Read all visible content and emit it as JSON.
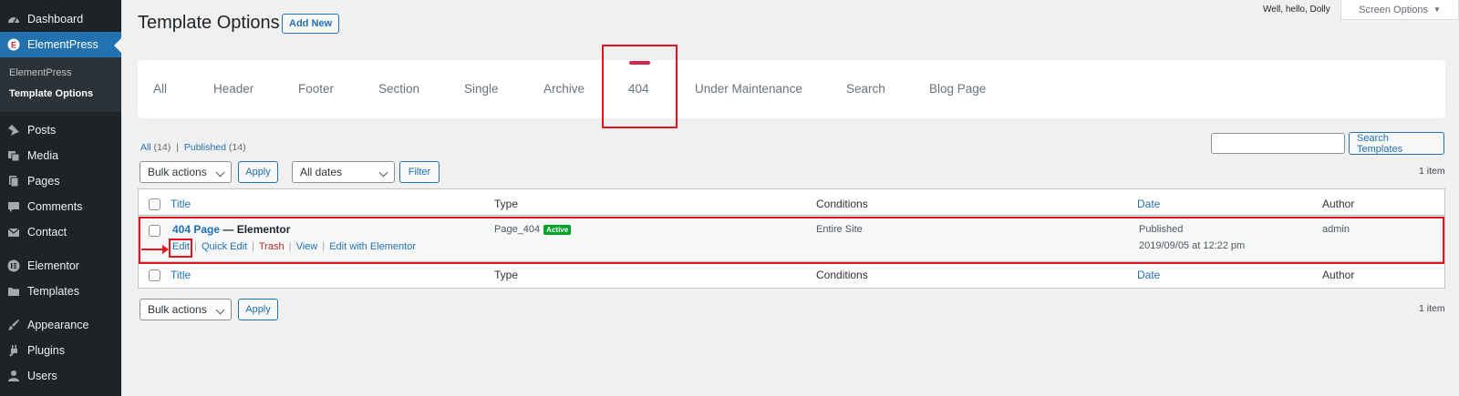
{
  "sidebar": {
    "items": [
      {
        "label": "Dashboard",
        "icon": "dashboard-icon"
      },
      {
        "label": "ElementPress",
        "icon": "elementpress-icon"
      },
      {
        "label": "Posts",
        "icon": "pin-icon"
      },
      {
        "label": "Media",
        "icon": "media-icon"
      },
      {
        "label": "Pages",
        "icon": "pages-icon"
      },
      {
        "label": "Comments",
        "icon": "comment-icon"
      },
      {
        "label": "Contact",
        "icon": "mail-icon"
      },
      {
        "label": "Elementor",
        "icon": "elementor-icon"
      },
      {
        "label": "Templates",
        "icon": "folder-icon"
      },
      {
        "label": "Appearance",
        "icon": "brush-icon"
      },
      {
        "label": "Plugins",
        "icon": "plugin-icon"
      },
      {
        "label": "Users",
        "icon": "user-icon"
      }
    ],
    "submenu": [
      "ElementPress",
      "Template Options"
    ]
  },
  "header": {
    "title": "Template Options",
    "add_new": "Add New",
    "greeting": "Well, hello, Dolly",
    "screen_options": "Screen Options"
  },
  "tabs": [
    "All",
    "Header",
    "Footer",
    "Section",
    "Single",
    "Archive",
    "404",
    "Under Maintenance",
    "Search",
    "Blog Page"
  ],
  "active_tab": "404",
  "filters": {
    "all": "All",
    "all_count": "(14)",
    "separator": "|",
    "published": "Published",
    "published_count": "(14)",
    "search_button": "Search Templates",
    "bulk_actions": "Bulk actions",
    "apply": "Apply",
    "all_dates": "All dates",
    "filter": "Filter",
    "item_count": "1 item"
  },
  "table": {
    "columns": [
      "Title",
      "Type",
      "Conditions",
      "Date",
      "Author"
    ],
    "row": {
      "title_link": "404 Page",
      "title_suffix": " — Elementor",
      "actions": [
        "Edit",
        "Quick Edit",
        "Trash",
        "View",
        "Edit with Elementor"
      ],
      "type": "Page_404",
      "badge": "Active",
      "conditions": "Entire Site",
      "date_status": "Published",
      "date_value": "2019/09/05 at 12:22 pm",
      "author": "admin"
    }
  },
  "colors": {
    "sidebar_bg": "#1d2327",
    "accent": "#2271b1",
    "active_tab_marker": "#d5254d",
    "annotation": "#e3131f",
    "badge": "#00a32a"
  }
}
